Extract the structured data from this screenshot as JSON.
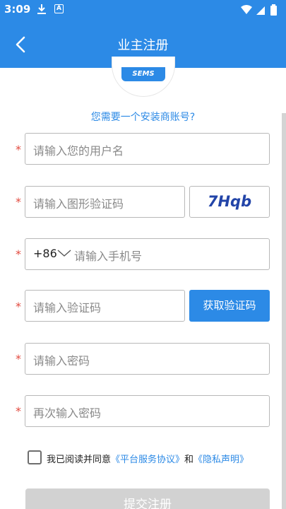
{
  "status_bar": {
    "time": "3:09"
  },
  "app_bar": {
    "title": "业主注册"
  },
  "logo": {
    "badge": "SEMS"
  },
  "installer_link": "您需要一个安装商账号?",
  "form": {
    "required_mark": "*",
    "username_placeholder": "请输入您的用户名",
    "captcha_placeholder": "请输入图形验证码",
    "captcha_text": "7Hqb",
    "phone_prefix": "+86",
    "phone_placeholder": "请输入手机号",
    "code_placeholder": "请输入验证码",
    "get_code_label": "获取验证码",
    "password_placeholder": "请输入密码",
    "confirm_password_placeholder": "再次输入密码"
  },
  "agreement": {
    "prefix": "我已阅读并同意",
    "terms_link": "《平台服务协议》",
    "and": "和",
    "privacy_link": "《隐私声明》"
  },
  "submit_label": "提交注册",
  "colors": {
    "primary": "#2c8ae6",
    "required": "#e24a3f",
    "disabled": "#d2d2d2"
  }
}
